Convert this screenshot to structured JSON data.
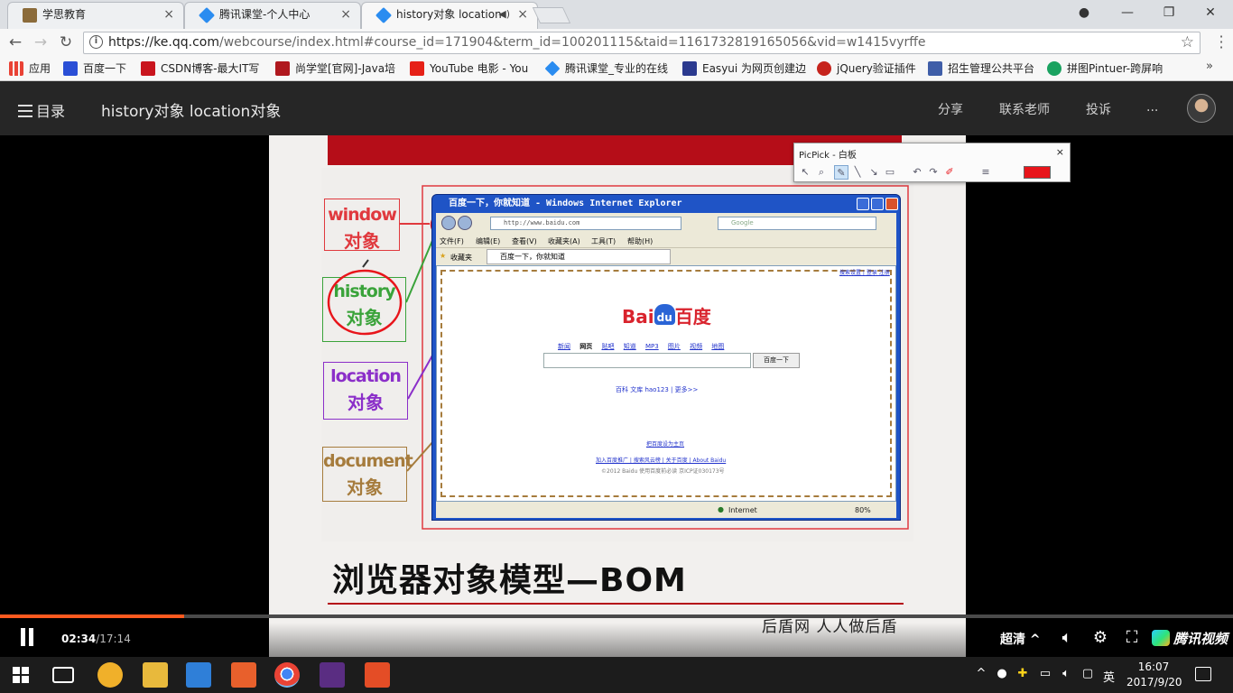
{
  "browser": {
    "tabs": [
      {
        "label": "学思教育",
        "favicon_color": "#8b6b3a"
      },
      {
        "label": "腾讯课堂-个人中心",
        "favicon_color": "#2a8cf0"
      },
      {
        "label": "history对象 location",
        "favicon_color": "#2a8cf0",
        "active": true
      }
    ],
    "url_host": "https://ke.qq.com",
    "url_rest": "/webcourse/index.html#course_id=171904&term_id=100201115&taid=1161732819165056&vid=w1415vyrffe",
    "bookmarks": [
      {
        "label": "应用",
        "color": "#e94235"
      },
      {
        "label": "百度一下",
        "color": "#2a4fd6"
      },
      {
        "label": "CSDN博客-最大IT写",
        "color": "#c9151e"
      },
      {
        "label": "尚学堂[官网]-Java培",
        "color": "#b0181e"
      },
      {
        "label": "YouTube 电影 - You",
        "color": "#e62117"
      },
      {
        "label": "腾讯课堂_专业的在线",
        "color": "#2a8cf0"
      },
      {
        "label": "Easyui 为网页创建边",
        "color": "#2b3a8f"
      },
      {
        "label": "jQuery验证插件",
        "color": "#c6241d"
      },
      {
        "label": "招生管理公共平台",
        "color": "#3f5ea8"
      },
      {
        "label": "拼图Pintuer-跨屏响",
        "color": "#1aa260"
      }
    ]
  },
  "app": {
    "menu_label": "目录",
    "course_title": "history对象 location对象",
    "links": [
      "分享",
      "联系老师",
      "投诉",
      "..."
    ]
  },
  "slide": {
    "labels": [
      {
        "en": "window",
        "cn": "对象",
        "color": "#e0393e"
      },
      {
        "en": "history",
        "cn": "对象",
        "color": "#3aa33a"
      },
      {
        "en": "location",
        "cn": "对象",
        "color": "#8b2fc9"
      },
      {
        "en": "document",
        "cn": "对象",
        "color": "#a67c3d"
      }
    ],
    "ie_title": "百度一下，你就知道 - Windows Internet Explorer",
    "ie_address": "http://www.baidu.com",
    "ie_search": "Google",
    "ie_menu": [
      "文件(F)",
      "编辑(E)",
      "查看(V)",
      "收藏夹(A)",
      "工具(T)",
      "帮助(H)"
    ],
    "ie_favorites": "收藏夹",
    "ie_tab": "百度一下，你就知道",
    "ie_status": "Internet",
    "ie_zoom": "80%",
    "baidu_top_links": "搜索设置 | 登录 注册",
    "baidu_logo_left": "Bai",
    "baidu_logo_paw": "du",
    "baidu_logo_right": "百度",
    "baidu_nav": [
      "新闻",
      "网页",
      "贴吧",
      "知道",
      "MP3",
      "图片",
      "视频",
      "地图"
    ],
    "baidu_button": "百度一下",
    "baidu_links": "百科  文库  hao123 | 更多>>",
    "baidu_homepage": "把百度设为主页",
    "baidu_footer": "加入百度推广 | 搜索风云榜 | 关于百度 | About Baidu",
    "baidu_copyright": "©2012 Baidu 使用百度前必读 京ICP证030173号",
    "title": "浏览器对象模型—BOM",
    "footer": "后盾网  人人做后盾"
  },
  "picpick": {
    "title": "PicPick - 白板",
    "close": "×",
    "pen_color": "#e8151b"
  },
  "player": {
    "current_time": "02:34",
    "duration": "/17:14",
    "progress_fraction": 0.149,
    "quality": "超清",
    "quality_caret": "^",
    "brand": "腾讯视频"
  },
  "taskbar": {
    "ime": "英",
    "time": "16:07",
    "date": "2017/9/20"
  }
}
